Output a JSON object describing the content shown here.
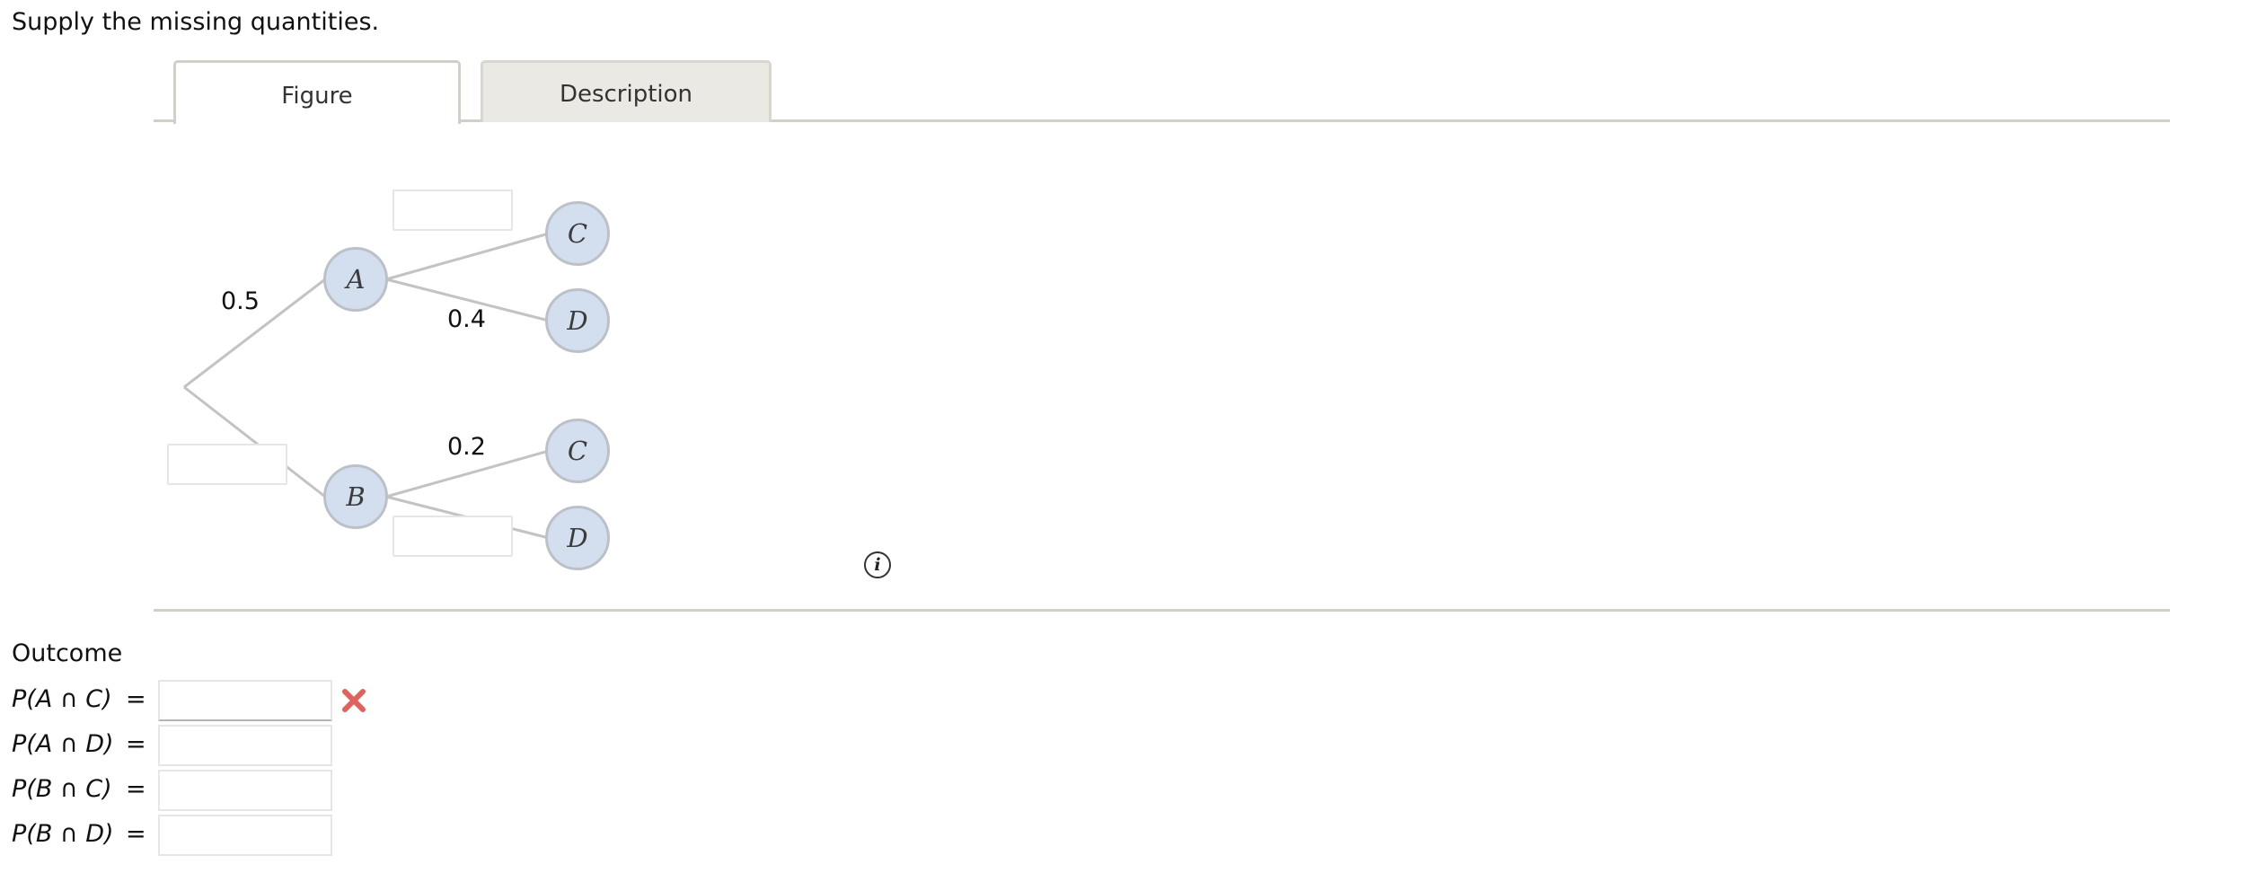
{
  "prompt": "Supply the missing quantities.",
  "tabs": [
    {
      "label": "Figure",
      "active": true
    },
    {
      "label": "Description",
      "active": false
    }
  ],
  "tree": {
    "nodes": {
      "a": "A",
      "b": "B",
      "ac": "C",
      "ad": "D",
      "bc": "C",
      "bd": "D"
    },
    "probabilities": {
      "root_to_a": "0.5",
      "a_to_d": "0.4",
      "b_to_c": "0.2"
    },
    "inputs": {
      "root_to_b": "",
      "a_to_c": "",
      "b_to_d": ""
    }
  },
  "info_icon": "info-icon",
  "outcome": {
    "heading": "Outcome",
    "equals": "=",
    "rows": [
      {
        "label": "P(A ∩ C)",
        "value": "",
        "error": true
      },
      {
        "label": "P(A ∩ D)",
        "value": "",
        "error": false
      },
      {
        "label": "P(B ∩ C)",
        "value": "",
        "error": false
      },
      {
        "label": "P(B ∩ D)",
        "value": "",
        "error": false
      }
    ]
  },
  "colors": {
    "node_fill": "#d3deef",
    "node_border": "#bcc1c8",
    "branch": "#c3c3c3",
    "tab_border": "#d2cfc6",
    "inactive_tab_bg": "#ebe9e4",
    "error_red": "#e0625c"
  }
}
